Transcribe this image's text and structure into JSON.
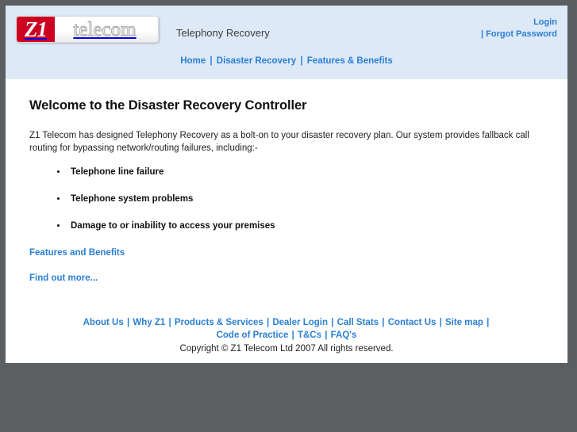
{
  "window": {
    "frame_color": "#5b5f61",
    "page_background": "#ffffff",
    "header_background": "#dde9f7",
    "link_color": "#2a7fd4",
    "logo_red": "#cc0022"
  },
  "header": {
    "logo": {
      "mark_text": "Z1",
      "word_text": "telecom"
    },
    "tagline": "Telephony Recovery",
    "account": {
      "login_label": "Login",
      "separator": "|",
      "forgot_password_label": "Forgot Password"
    },
    "nav": {
      "separator": "|",
      "items": [
        {
          "label": "Home"
        },
        {
          "label": "Disaster Recovery"
        },
        {
          "label": "Features & Benefits"
        }
      ]
    }
  },
  "main": {
    "title": "Welcome to the Disaster Recovery Controller",
    "intro": "Z1 Telecom has designed Telephony Recovery as a bolt-on to your disaster recovery plan. Our system provides fallback call routing for bypassing network/routing failures, including:-",
    "bullets": [
      "Telephone line failure",
      "Telephone system problems",
      "Damage to or inability to access your premises"
    ],
    "links": [
      {
        "label": "Features and Benefits"
      },
      {
        "label": "Find out more..."
      }
    ]
  },
  "footer": {
    "separator": "|",
    "row1": [
      {
        "label": "About Us"
      },
      {
        "label": "Why Z1"
      },
      {
        "label": "Products & Services"
      },
      {
        "label": "Dealer Login"
      },
      {
        "label": "Call Stats"
      },
      {
        "label": "Contact Us"
      },
      {
        "label": "Site map"
      }
    ],
    "row2": [
      {
        "label": "Code of Practice"
      },
      {
        "label": "T&Cs"
      },
      {
        "label": "FAQ's"
      }
    ],
    "copyright": "Copyright © Z1 Telecom Ltd 2007 All rights reserved."
  }
}
